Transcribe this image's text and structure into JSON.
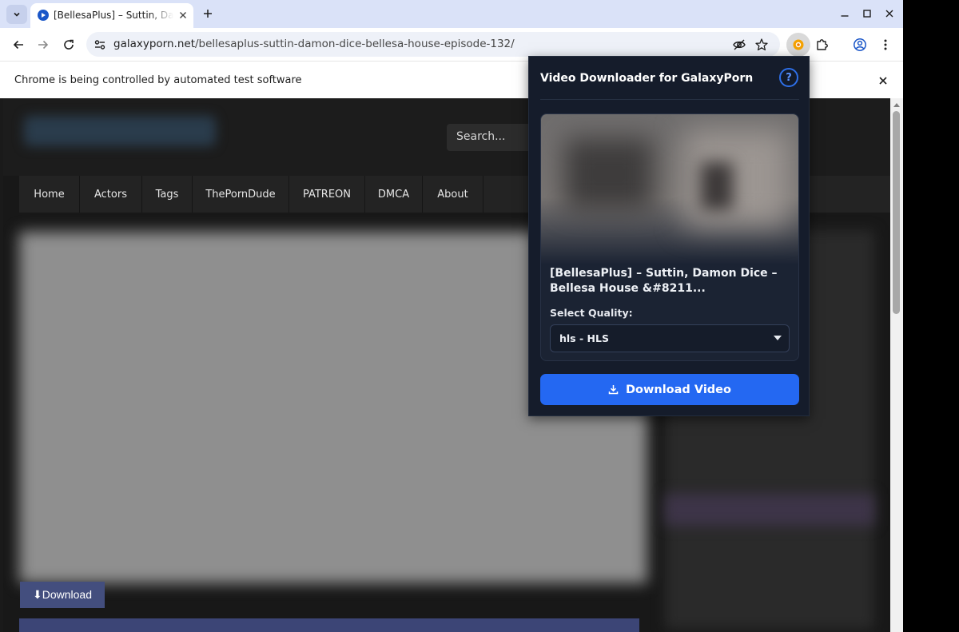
{
  "browser": {
    "tab_title": "[BellesaPlus] – Suttin, Damon Dice – Bellesa House – Episode 132",
    "url_domain": "galaxyporn.net",
    "url_path": "/bellesaplus-suttin-damon-dice-bellesa-house-episode-132/",
    "infobar_text": "Chrome is being controlled by automated test software"
  },
  "site": {
    "search_placeholder": "Search...",
    "nav": [
      "Home",
      "Actors",
      "Tags",
      "ThePornDude",
      "PATREON",
      "DMCA",
      "About"
    ],
    "download_label": "⬇Download"
  },
  "popup": {
    "title": "Video Downloader for GalaxyPorn",
    "help_label": "?",
    "video_title": "[BellesaPlus] – Suttin, Damon Dice – Bellesa House &#8211...",
    "quality_label": "Select Quality:",
    "quality_value": "hls - HLS",
    "download_button": "Download Video"
  },
  "colors": {
    "accent": "#2468f2",
    "popup_bg": "#151c2b",
    "site_button": "#434e7e"
  }
}
